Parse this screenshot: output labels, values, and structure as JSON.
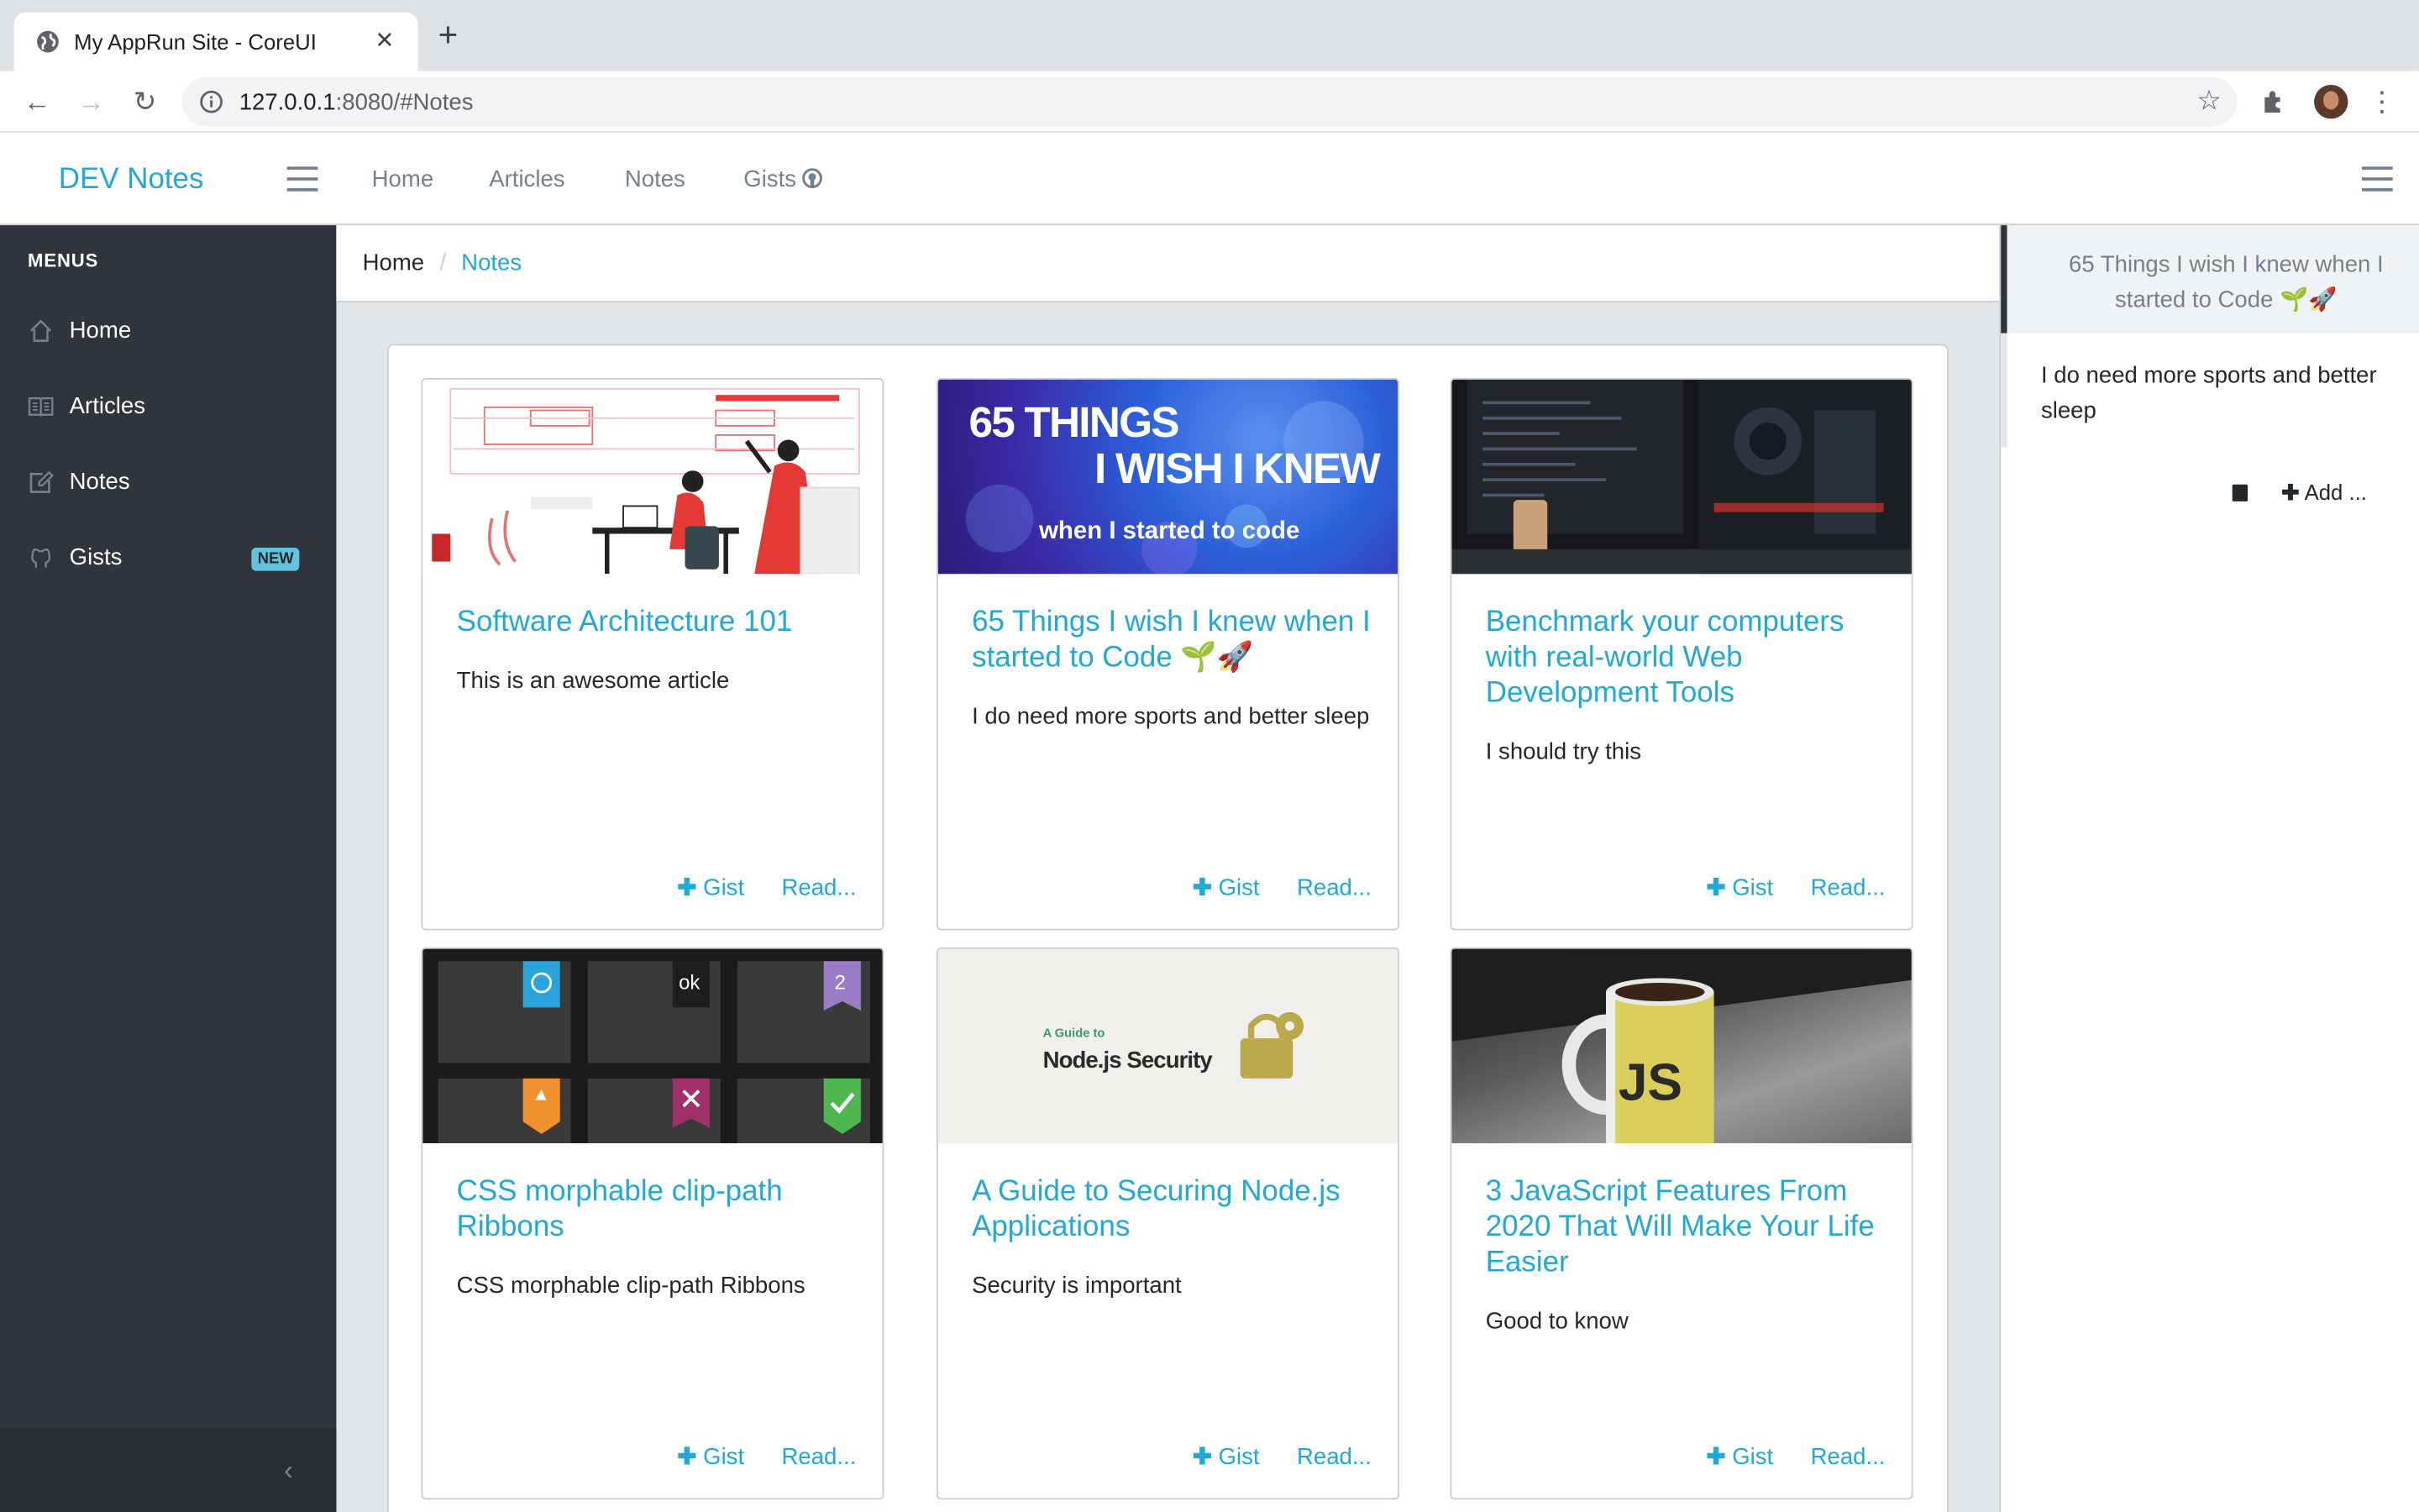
{
  "browser": {
    "tab_title": "My AppRun Site - CoreUI",
    "url_host": "127.0.0.1",
    "url_rest": ":8080/#Notes"
  },
  "header": {
    "brand": "DEV Notes",
    "nav": [
      "Home",
      "Articles",
      "Notes",
      "Gists"
    ]
  },
  "sidebar": {
    "title": "MENUS",
    "items": [
      {
        "label": "Home",
        "icon": "home-icon"
      },
      {
        "label": "Articles",
        "icon": "book-icon"
      },
      {
        "label": "Notes",
        "icon": "note-icon"
      },
      {
        "label": "Gists",
        "icon": "github-icon",
        "badge": "NEW"
      }
    ]
  },
  "breadcrumb": {
    "home": "Home",
    "sep": "/",
    "current": "Notes"
  },
  "cards": [
    {
      "title": "Software Architecture 101",
      "text": "This is an awesome article",
      "gist": "Gist",
      "read": "Read..."
    },
    {
      "title": "65 Things I wish I knew when I started to Code 🌱🚀",
      "text": "I do need more sports and better sleep",
      "gist": "Gist",
      "read": "Read...",
      "image_text": [
        "65 THINGS",
        "I WISH I KNEW",
        "when I started to code"
      ]
    },
    {
      "title": "Benchmark your computers with real-world Web Development Tools",
      "text": "I should try this",
      "gist": "Gist",
      "read": "Read..."
    },
    {
      "title": "CSS morphable clip-path Ribbons",
      "text": "CSS morphable clip-path Ribbons",
      "gist": "Gist",
      "read": "Read...",
      "image_text": [
        "ok",
        "2"
      ]
    },
    {
      "title": "A Guide to Securing Node.js Applications",
      "text": "Security is important",
      "gist": "Gist",
      "read": "Read...",
      "image_text": [
        "A Guide to",
        "Node.js Security"
      ]
    },
    {
      "title": "3 JavaScript Features From 2020 That Will Make Your Life Easier",
      "text": "Good to know",
      "gist": "Gist",
      "read": "Read...",
      "image_text": [
        "JS"
      ]
    }
  ],
  "aside": {
    "selected": "65 Things I wish I knew when I started to Code 🌱🚀",
    "note": "I do need more sports and better sleep",
    "add": "Add ..."
  },
  "colors": {
    "accent": "#20a8d8",
    "sidebar": "#2f353a",
    "badge": "#63c2de"
  }
}
